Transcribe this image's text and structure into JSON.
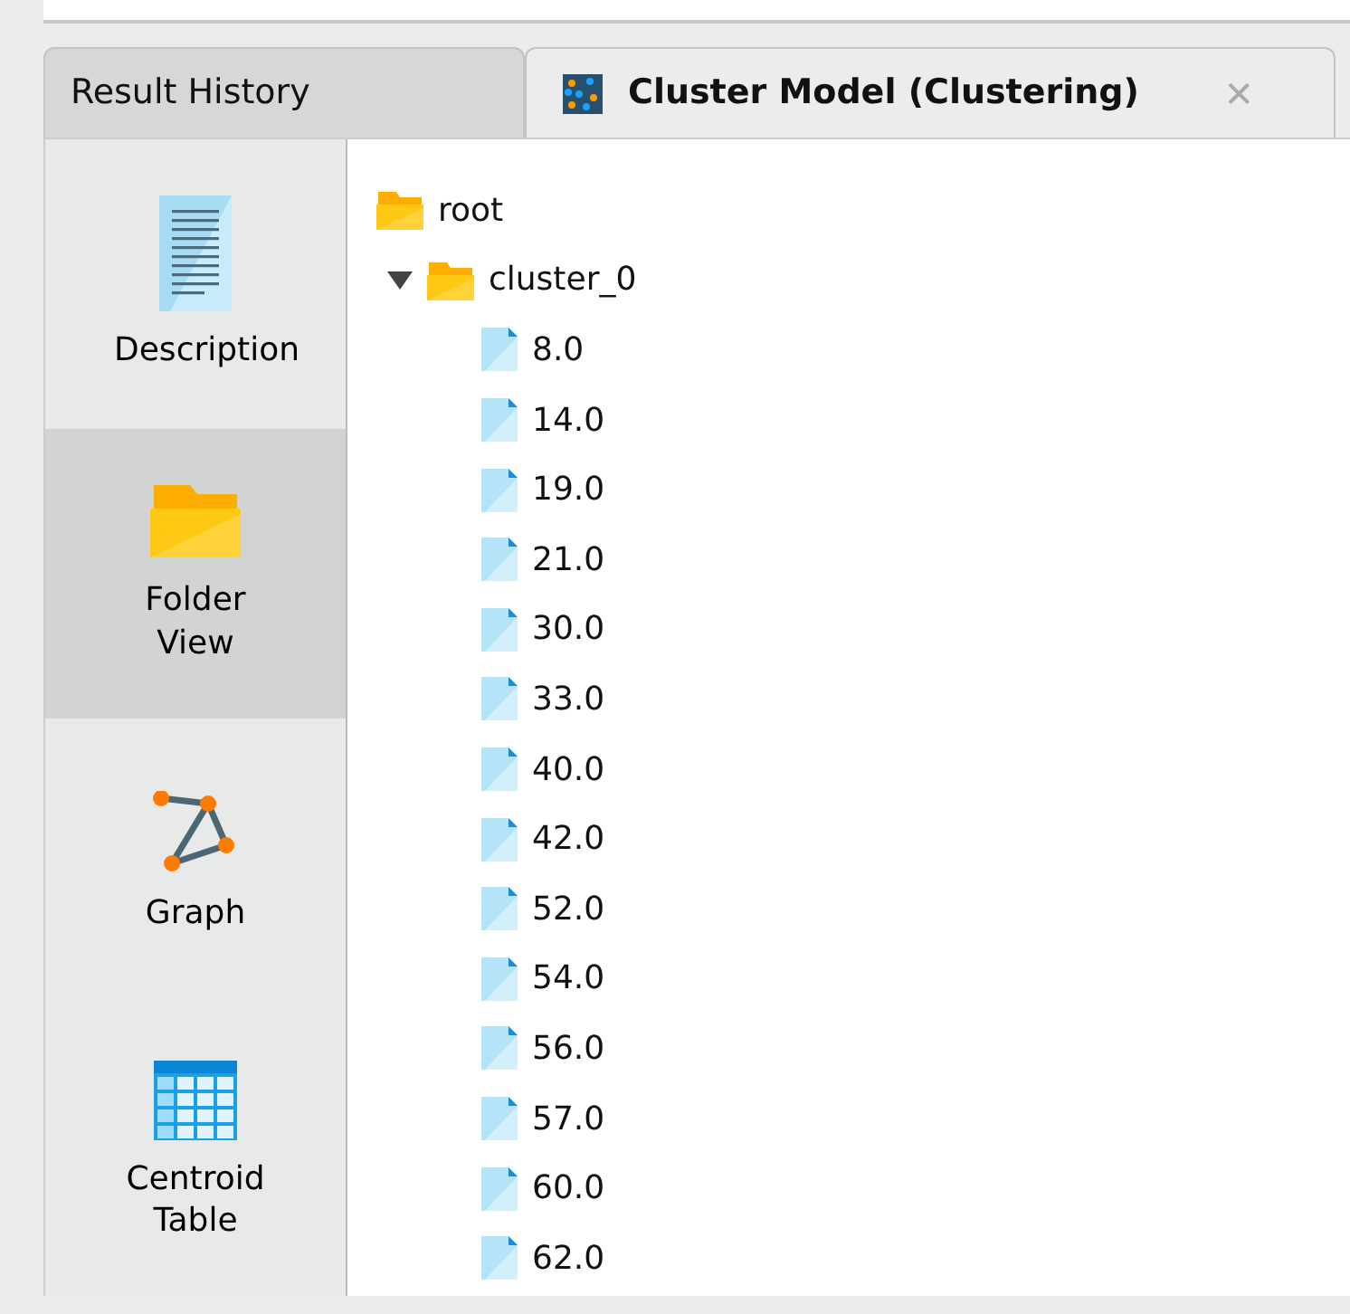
{
  "tabs": [
    {
      "label": "Result History",
      "selected": false,
      "icon": false
    },
    {
      "label": "Cluster Model (Clustering)",
      "selected": true,
      "icon": true,
      "closable": true,
      "close_glyph": "✕"
    }
  ],
  "sidebar": {
    "items": [
      {
        "label": "Description",
        "kind": "document",
        "selected": false
      },
      {
        "label": "Folder View",
        "kind": "folder",
        "selected": true
      },
      {
        "label": "Graph",
        "kind": "graph",
        "selected": false
      },
      {
        "label": "Centroid Table",
        "kind": "table",
        "selected": false
      }
    ]
  },
  "tree": [
    {
      "label": "root",
      "kind": "folder",
      "children": [
        {
          "label": "cluster_0",
          "kind": "folder",
          "expanded": true,
          "children": [
            {
              "label": "8.0",
              "kind": "file"
            },
            {
              "label": "14.0",
              "kind": "file"
            },
            {
              "label": "19.0",
              "kind": "file"
            },
            {
              "label": "21.0",
              "kind": "file"
            },
            {
              "label": "30.0",
              "kind": "file"
            },
            {
              "label": "33.0",
              "kind": "file"
            },
            {
              "label": "40.0",
              "kind": "file"
            },
            {
              "label": "42.0",
              "kind": "file"
            },
            {
              "label": "52.0",
              "kind": "file"
            },
            {
              "label": "54.0",
              "kind": "file"
            },
            {
              "label": "56.0",
              "kind": "file"
            },
            {
              "label": "57.0",
              "kind": "file"
            },
            {
              "label": "60.0",
              "kind": "file"
            },
            {
              "label": "62.0",
              "kind": "file"
            }
          ]
        }
      ]
    }
  ]
}
